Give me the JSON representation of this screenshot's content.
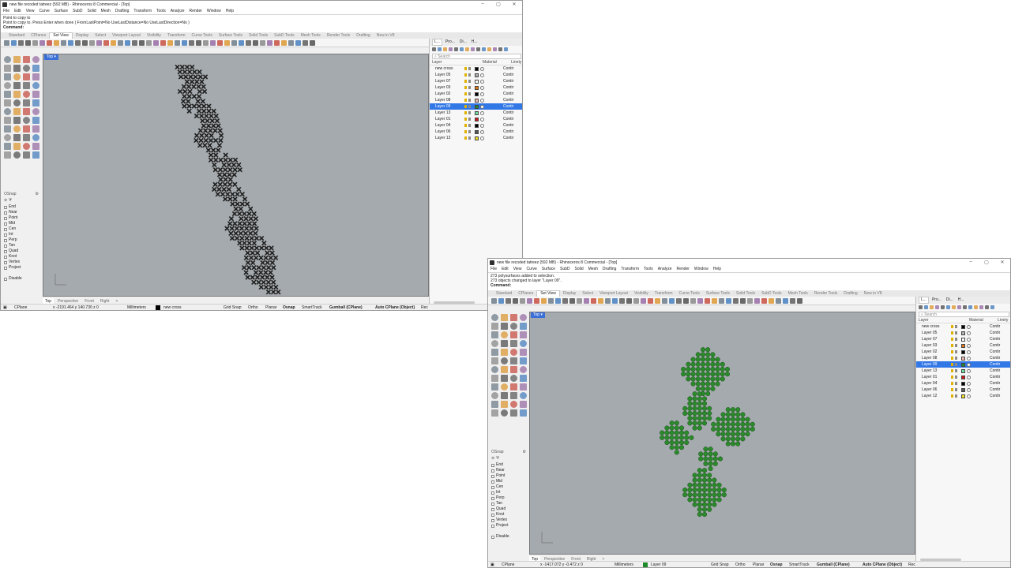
{
  "window1": {
    "title": "new file recoded tatreez (592 MB) - Rhinoceros 8 Commercial - [Top]",
    "command_history": [
      "Point to copy to",
      "Point to copy to. Press Enter when done ( FromLastPoint=No  UseLastDistance=No  UseLastDirection=No )"
    ],
    "command_prompt": "Command:",
    "viewport_label": "Top ▾",
    "coords": "x -2191.464   y 140.730   z 0",
    "current_layer": "new cross",
    "pattern_color": "#1e1e1e"
  },
  "window2": {
    "title": "new file recoded tatreez (592 MB) - Rhinoceros 8 Commercial - [Top]",
    "command_history": [
      "273 polysurfaces added to selection.",
      "273 objects changed to layer \"Layer 09\"."
    ],
    "command_prompt": "Command:",
    "viewport_label": "Top ▾",
    "coords": "x -1417.072   y -0.472   z 0",
    "current_layer": "Layer 09",
    "pattern_color": "#2b8a2b"
  },
  "menu": [
    "File",
    "Edit",
    "View",
    "Curve",
    "Surface",
    "SubD",
    "Solid",
    "Mesh",
    "Drafting",
    "Transform",
    "Tools",
    "Analyze",
    "Render",
    "Window",
    "Help"
  ],
  "toolbar_tabs": [
    "Standard",
    "CPlanes",
    "Set View",
    "Display",
    "Select",
    "Viewport Layout",
    "Visibility",
    "Transform",
    "Curve Tools",
    "Surface Tools",
    "Solid Tools",
    "SubD Tools",
    "Mesh Tools",
    "Render Tools",
    "Drafting",
    "New in V8"
  ],
  "toolbar_active_tab": "Set View",
  "viewport_tabs": [
    "Top",
    "Perspective",
    "Front",
    "Right",
    "+"
  ],
  "osnap": {
    "title": "OSnap",
    "items": [
      "End",
      "Near",
      "Point",
      "Mid",
      "Cen",
      "Int",
      "Perp",
      "Tan",
      "Quad",
      "Knot",
      "Vertex",
      "Project"
    ],
    "disable": "Disable"
  },
  "status": {
    "cplane": "CPlane",
    "units": "Millimeters",
    "grid_snap": "Grid Snap",
    "ortho": "Ortho",
    "planar": "Planar",
    "osnap": "Osnap",
    "smarttrack": "SmartTrack",
    "gumball": "Gumball (CPlane)",
    "auto_cplane": "Auto CPlane (Object)",
    "record": "Rec"
  },
  "panel_tabs": [
    "L...",
    "Pro...",
    "Di...",
    "H..."
  ],
  "layer_panel": {
    "search_placeholder": "Search",
    "col_layer": "Layer",
    "col_material": "Material",
    "col_linetype": "Linety",
    "selected": "Layer 09",
    "layers": [
      {
        "name": "new cross",
        "color": "#000000",
        "linetype": "Contir"
      },
      {
        "name": "Layer 05",
        "color": "#b0b0b0",
        "linetype": "Contir"
      },
      {
        "name": "Layer 07",
        "color": "#ffffff",
        "linetype": "Contir"
      },
      {
        "name": "Layer 03",
        "color": "#e07a1a",
        "linetype": "Contir"
      },
      {
        "name": "Layer 02",
        "color": "#000000",
        "linetype": "Contir"
      },
      {
        "name": "Layer 08",
        "color": "#f0b8b0",
        "linetype": "Contir"
      },
      {
        "name": "Layer 09",
        "color": "#1f8a2a",
        "linetype": "Contir"
      },
      {
        "name": "Layer 13",
        "color": "#70e0a0",
        "linetype": "Contir"
      },
      {
        "name": "Layer 01",
        "color": "#d01818",
        "linetype": "Contir"
      },
      {
        "name": "Layer 04",
        "color": "#000000",
        "linetype": "Contir"
      },
      {
        "name": "Layer 06",
        "color": "#555555",
        "linetype": "Contir"
      },
      {
        "name": "Layer 12",
        "color": "#f0e020",
        "linetype": "Contir"
      }
    ]
  }
}
